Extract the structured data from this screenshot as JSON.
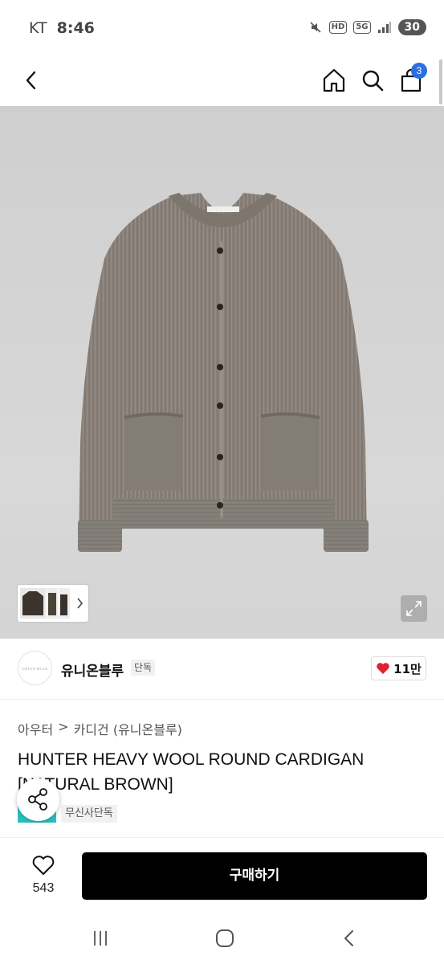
{
  "status_bar": {
    "carrier": "KT",
    "time": "8:46",
    "hd_label": "HD",
    "network_label": "5G",
    "battery": "30"
  },
  "header": {
    "cart_count": "3"
  },
  "brand": {
    "logo_text": "UNION BLUE",
    "name": "유니온블루",
    "exclusive_label": "단독",
    "like_count": "11만"
  },
  "product": {
    "breadcrumb": [
      "아우터",
      ">",
      "카디건 (유니온블루)"
    ],
    "title": "HUNTER HEAVY WOOL ROUND CARDIGAN [NATURAL BROWN]",
    "tags": [
      "무신사단독"
    ]
  },
  "actions": {
    "wish_count": "543",
    "buy_label": "구매하기"
  },
  "colors": {
    "accent_badge": "#2c6fe0",
    "heart": "#e2202e",
    "tag_teal": "#2bbfc1",
    "cardigan": "#8a827a"
  },
  "icons": [
    "back-icon",
    "home-icon",
    "search-icon",
    "bag-icon",
    "expand-icon",
    "heart-icon",
    "share-icon",
    "heart-outline-icon",
    "recent-apps-icon",
    "home-nav-icon",
    "back-nav-icon"
  ]
}
